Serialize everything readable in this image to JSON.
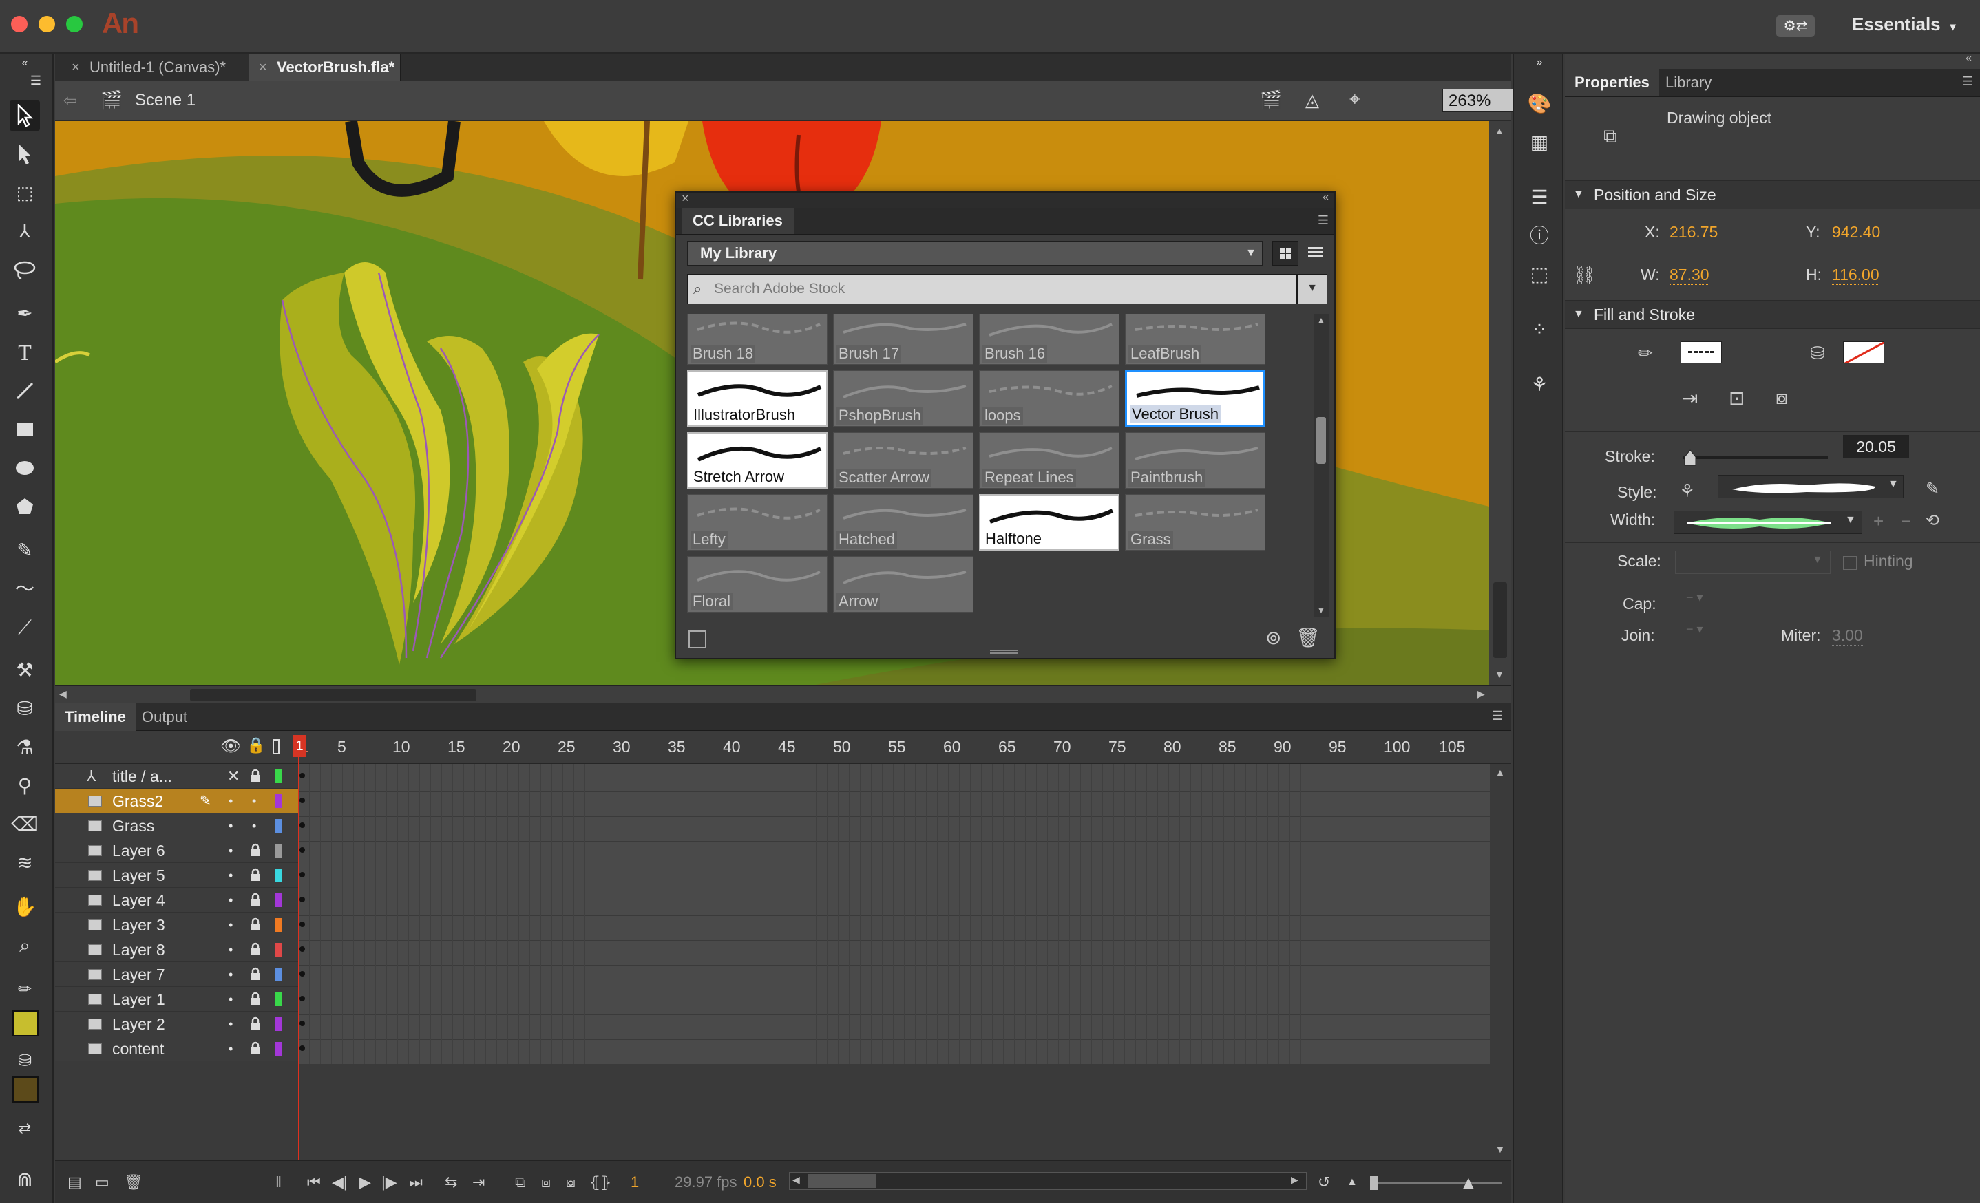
{
  "app": {
    "icon_text": "An",
    "workspace_label": "Essentials",
    "workspace_switch": "⚙⇄"
  },
  "colors": {
    "accent": "#f2a62b",
    "active_layer": "#b7821f",
    "playhead": "#d63524",
    "stage": "#c98d0d",
    "fill_swatch": "#c7be2e",
    "stroke_swatch": "#5c4a1a"
  },
  "documents": {
    "tabs": [
      {
        "label": "Untitled-1 (Canvas)*",
        "active": false
      },
      {
        "label": "VectorBrush.fla*",
        "active": true
      }
    ]
  },
  "editbar": {
    "scene": "Scene 1",
    "zoom": "263%"
  },
  "cc_libraries": {
    "tab": "CC Libraries",
    "library": "My Library",
    "search_placeholder": "Search Adobe Stock",
    "brushes": [
      {
        "label": "Brush 18",
        "style": "grey"
      },
      {
        "label": "Brush 17",
        "style": "grey"
      },
      {
        "label": "Brush 16",
        "style": "grey"
      },
      {
        "label": "LeafBrush",
        "style": "grey"
      },
      {
        "label": "IllustratorBrush",
        "style": "white"
      },
      {
        "label": "PshopBrush",
        "style": "grey"
      },
      {
        "label": "loops",
        "style": "grey"
      },
      {
        "label": "Vector Brush",
        "style": "selected"
      },
      {
        "label": "Stretch Arrow",
        "style": "white"
      },
      {
        "label": "Scatter Arrow",
        "style": "grey"
      },
      {
        "label": "Repeat Lines",
        "style": "grey"
      },
      {
        "label": "Paintbrush",
        "style": "grey"
      },
      {
        "label": "Lefty",
        "style": "grey"
      },
      {
        "label": "Hatched",
        "style": "grey"
      },
      {
        "label": "Halftone",
        "style": "white"
      },
      {
        "label": "Grass",
        "style": "grey"
      },
      {
        "label": "Floral",
        "style": "grey"
      },
      {
        "label": "Arrow",
        "style": "grey"
      }
    ]
  },
  "timeline": {
    "tabs": [
      {
        "label": "Timeline",
        "active": true
      },
      {
        "label": "Output",
        "active": false
      }
    ],
    "frame_numbers": [
      "1",
      "5",
      "10",
      "15",
      "20",
      "25",
      "30",
      "35",
      "40",
      "45",
      "50",
      "55",
      "60",
      "65",
      "70",
      "75",
      "80",
      "85",
      "90",
      "95",
      "100",
      "105"
    ],
    "layers": [
      {
        "name": "title / a...",
        "color": "#39d84a",
        "active": false,
        "locked": true
      },
      {
        "name": "Grass2",
        "color": "#a337d8",
        "active": true,
        "locked": false
      },
      {
        "name": "Grass",
        "color": "#5c8fe0",
        "active": false,
        "locked": false
      },
      {
        "name": "Layer 6",
        "color": "#9a9a9a",
        "active": false,
        "locked": true
      },
      {
        "name": "Layer 5",
        "color": "#39d8e0",
        "active": false,
        "locked": true
      },
      {
        "name": "Layer 4",
        "color": "#a337d8",
        "active": false,
        "locked": true
      },
      {
        "name": "Layer 3",
        "color": "#f07a22",
        "active": false,
        "locked": true
      },
      {
        "name": "Layer 8",
        "color": "#e04848",
        "active": false,
        "locked": true
      },
      {
        "name": "Layer 7",
        "color": "#5c8fe0",
        "active": false,
        "locked": true
      },
      {
        "name": "Layer 1",
        "color": "#39d84a",
        "active": false,
        "locked": true
      },
      {
        "name": "Layer 2",
        "color": "#a337d8",
        "active": false,
        "locked": true
      },
      {
        "name": "content",
        "color": "#a337d8",
        "active": false,
        "locked": true
      }
    ],
    "current_frame": "1",
    "playhead_label": "1",
    "fps": "29.97 fps",
    "time": "0.0 s"
  },
  "properties": {
    "tabs": [
      {
        "label": "Properties",
        "active": true
      },
      {
        "label": "Library",
        "active": false
      }
    ],
    "object_type": "Drawing object",
    "position_size": {
      "title": "Position and Size",
      "x_label": "X:",
      "x": "216.75",
      "y_label": "Y:",
      "y": "942.40",
      "w_label": "W:",
      "w": "87.30",
      "h_label": "H:",
      "h": "116.00"
    },
    "fill_stroke": {
      "title": "Fill and Stroke",
      "stroke_label": "Stroke:",
      "stroke": "20.05",
      "style_label": "Style:",
      "width_label": "Width:",
      "scale_label": "Scale:",
      "hinting_label": "Hinting",
      "cap_label": "Cap:",
      "join_label": "Join:",
      "miter_label": "Miter:",
      "miter": "3.00"
    }
  }
}
